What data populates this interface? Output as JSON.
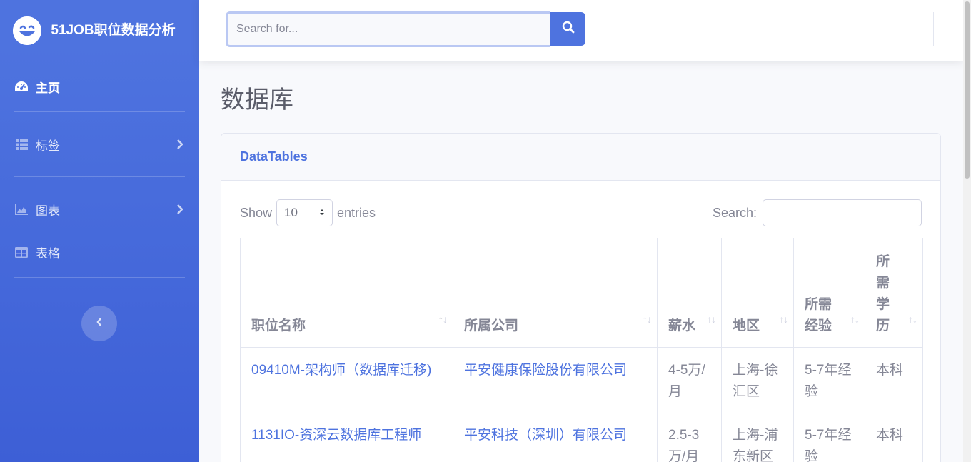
{
  "brand": {
    "title": "51JOB职位数据分析"
  },
  "sidebar": {
    "items": [
      {
        "label": "主页",
        "icon": "dashboard-icon",
        "active": true
      },
      {
        "label": "标签",
        "icon": "grid-icon",
        "has_submenu": true
      },
      {
        "label": "图表",
        "icon": "area-chart-icon",
        "has_submenu": true
      },
      {
        "label": "表格",
        "icon": "table-icon"
      }
    ]
  },
  "topbar": {
    "search_placeholder": "Search for..."
  },
  "page": {
    "title": "数据库"
  },
  "card": {
    "title": "DataTables"
  },
  "datatable": {
    "show_label": "Show",
    "entries_value": "10",
    "entries_label": "entries",
    "search_label": "Search:",
    "columns": [
      "职位名称",
      "所属公司",
      "薪水",
      "地区",
      "所需经验",
      "所需学历"
    ],
    "rows": [
      [
        "09410M-架构师（数据库迁移)",
        "平安健康保险股份有限公司",
        "4-5万/月",
        "上海-徐汇区",
        "5-7年经验",
        "本科"
      ],
      [
        "1131IO-资深云数据库工程师",
        "平安科技（深圳）有限公司",
        "2.5-3万/月",
        "上海-浦东新区",
        "5-7年经验",
        "本科"
      ]
    ]
  },
  "colors": {
    "primary": "#4e73df",
    "text": "#858796"
  }
}
